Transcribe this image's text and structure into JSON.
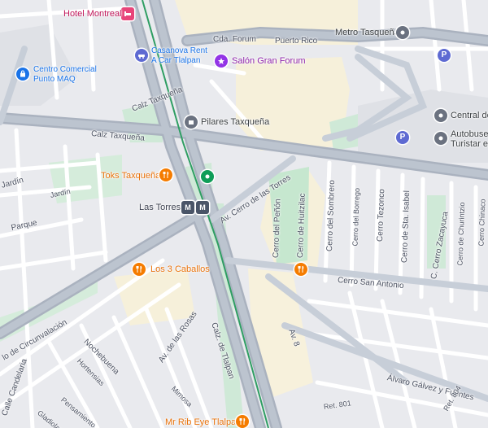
{
  "colors": {
    "pink": "#e8457a",
    "blue": "#1a73e8",
    "purple": "#9334e6",
    "orange": "#f57c00",
    "gray": "#6b7280",
    "green": "#0f9d58",
    "parking": "#5e6ad2"
  },
  "pois": {
    "hotel_montreal": "Hotel Montreal",
    "casanova_1": "Casanova Rent",
    "casanova_2": "A Car Tlalpan",
    "salon_gran_forum": "Salón Gran Forum",
    "centro_comercial_1": "Centro Comercial",
    "centro_comercial_2": "Punto MAQ",
    "metro_tasquena": "Metro Tasqueña",
    "central_de": "Central de",
    "autobuses_1": "Autobuses",
    "autobuses_2": "Turistar en",
    "pilares": "Pilares Taxqueña",
    "toks": "Toks Taxqueña",
    "las_torres": "Las Torres",
    "los_3_caballos": "Los 3 Caballos",
    "mr_rib": "Mr Rib Eye Tlalpan"
  },
  "streets": {
    "cda_forum": "Cda. Forum",
    "puerto_rico": "Puerto Rico",
    "calz_taxquena_1": "Calz Taxqueña",
    "calz_taxquena_2": "Calz Taxqueña",
    "jardin_1": "Jardín",
    "jardin_2": "Jardín",
    "parque": "Parque",
    "av_cerro_torres": "Av. Cerro de las Torres",
    "cerro_penon": "Cerro del Peñón",
    "cerro_huitzilac": "Cerro de Huitzilac",
    "cerro_sombrero": "Cerro del Sombrero",
    "cerro_borrego": "Cerro del Borrego",
    "cerro_tezonco": "Cerro Tezonco",
    "cerro_sta_isabel": "Cerro de Sta. Isabel",
    "c_cerro_zacayuca": "C. Cerro Zacayuca",
    "cerro_churintzio": "Cerro de Churintzio",
    "cerro_chinaco": "Cerro Chinaco",
    "cerro_san_antonio": "Cerro San Antonio",
    "circunvalacion": "lo de Circunvalación",
    "nochebuena": "Nochebuena",
    "hortensias": "Hortensias",
    "av_de_las_rosas": "Av. de las Rosas",
    "calz_de_tlalpan": "Calz. de Tlalpan",
    "av_8": "Av. 8",
    "mimosa": "Mimosa",
    "calle_candelaria": "Calle Candelaria",
    "pensamiento": "Pensamiento",
    "gladiolas": "Gladiolas",
    "alvaro_galvez": "Álvaro Gálvez y Fuentes",
    "ret_801": "Ret. 801",
    "ret_804": "Ret. 804"
  },
  "badges": {
    "metro_a": "M",
    "metro_b": "M",
    "parking": "P"
  }
}
